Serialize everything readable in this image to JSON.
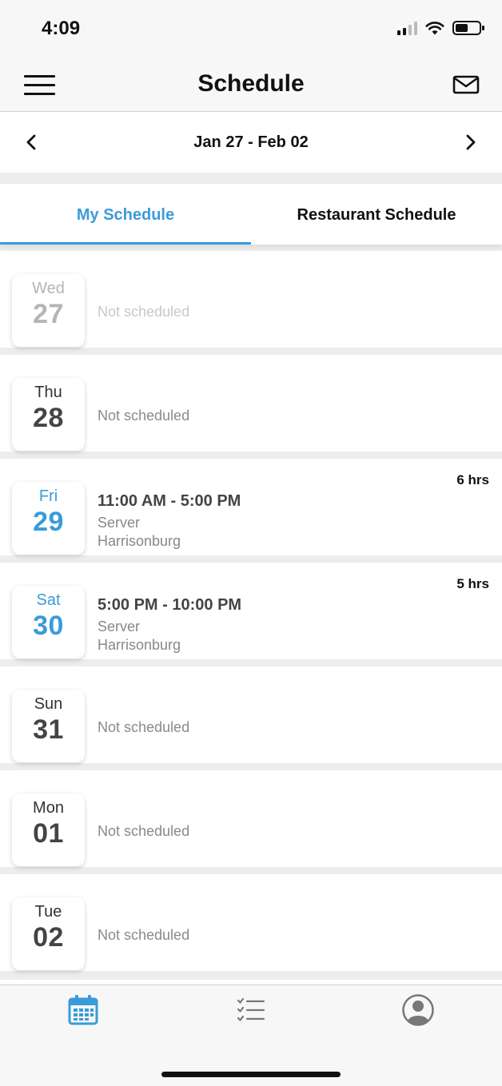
{
  "status_bar": {
    "time": "4:09"
  },
  "header": {
    "title": "Schedule",
    "menu_icon": "hamburger-menu-icon",
    "mail_icon": "mail-icon"
  },
  "week": {
    "range": "Jan 27 - Feb 02"
  },
  "tabs": [
    {
      "label": "My Schedule",
      "active": true
    },
    {
      "label": "Restaurant Schedule",
      "active": false
    }
  ],
  "days": [
    {
      "name": "Wed",
      "num": "27",
      "status": "Not scheduled"
    },
    {
      "name": "Thu",
      "num": "28",
      "status": "Not scheduled"
    },
    {
      "name": "Fri",
      "num": "29",
      "time": "11:00 AM - 5:00 PM",
      "role": "Server",
      "location": "Harrisonburg",
      "hours": "6 hrs"
    },
    {
      "name": "Sat",
      "num": "30",
      "time": "5:00 PM - 10:00 PM",
      "role": "Server",
      "location": "Harrisonburg",
      "hours": "5 hrs"
    },
    {
      "name": "Sun",
      "num": "31",
      "status": "Not scheduled"
    },
    {
      "name": "Mon",
      "num": "01",
      "status": "Not scheduled"
    },
    {
      "name": "Tue",
      "num": "02",
      "status": "Not scheduled"
    }
  ],
  "bottom_tabs": [
    {
      "icon": "calendar-icon",
      "active": true
    },
    {
      "icon": "checklist-icon",
      "active": false
    },
    {
      "icon": "profile-icon",
      "active": false
    }
  ],
  "colors": {
    "accent": "#3a9bd9",
    "text": "#444444",
    "muted": "#8a8a8a",
    "separator": "#ededed"
  }
}
